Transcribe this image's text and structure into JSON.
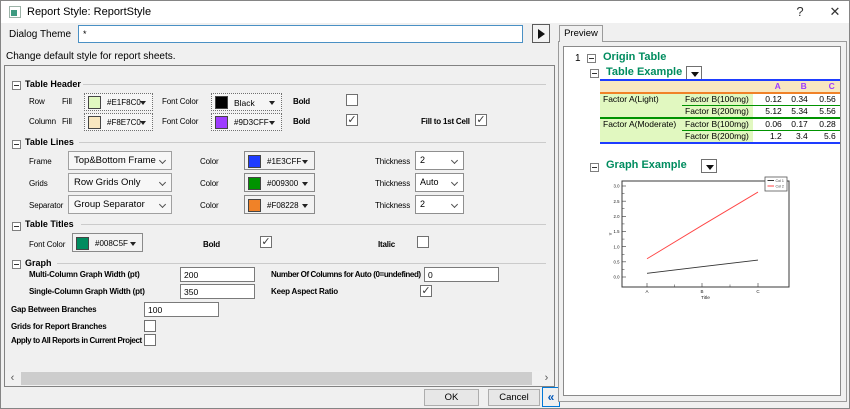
{
  "window": {
    "title": "Report Style: ReportStyle",
    "help": "?",
    "close": "✕"
  },
  "theme_row": {
    "label": "Dialog Theme",
    "value": "*"
  },
  "description": "Change default style for report sheets.",
  "sections": {
    "table_header": {
      "title": "Table Header",
      "row": {
        "label": "Row",
        "fill_label": "Fill",
        "fill_hex": "#E1F8C0",
        "font_color_label": "Font Color",
        "font_color_name": "Black",
        "font_color_hex": "#000000",
        "bold_label": "Bold",
        "bold_checked": false
      },
      "column": {
        "label": "Column",
        "fill_label": "Fill",
        "fill_hex": "#F8E7C0",
        "font_color_label": "Font Color",
        "font_color_hex": "#9D3CFF",
        "bold_label": "Bold",
        "bold_checked": true,
        "fill_first_label": "Fill to 1st Cell",
        "fill_first_checked": true
      }
    },
    "table_lines": {
      "title": "Table Lines",
      "rows": [
        {
          "label": "Frame",
          "value": "Top&Bottom Frame",
          "color_label": "Color",
          "color_hex": "#1E3CFF",
          "thickness_label": "Thickness",
          "thickness": "2"
        },
        {
          "label": "Grids",
          "value": "Row Grids Only",
          "color_label": "Color",
          "color_hex": "#009300",
          "thickness_label": "Thickness",
          "thickness": "Auto"
        },
        {
          "label": "Separator",
          "value": "Group Separator",
          "color_label": "Color",
          "color_hex": "#F08228",
          "thickness_label": "Thickness",
          "thickness": "2"
        }
      ]
    },
    "table_titles": {
      "title": "Table Titles",
      "font_color_label": "Font Color",
      "font_color_hex": "#008C5F",
      "bold_label": "Bold",
      "bold_checked": true,
      "italic_label": "Italic",
      "italic_checked": false
    },
    "graph": {
      "title": "Graph",
      "multi_label": "Multi-Column Graph Width (pt)",
      "multi_value": "200",
      "columns_auto_label": "Number Of Columns for Auto (0=undefined)",
      "columns_auto_value": "0",
      "single_label": "Single-Column Graph Width (pt)",
      "single_value": "350",
      "keep_aspect_label": "Keep Aspect Ratio",
      "keep_aspect_checked": true,
      "gap_label": "Gap Between Branches",
      "gap_value": "100",
      "grids_label": "Grids for Report Branches",
      "grids_checked": false,
      "apply_label": "Apply to All Reports in Current Project",
      "apply_checked": false
    }
  },
  "buttons": {
    "ok": "OK",
    "cancel": "Cancel",
    "collapse": "«"
  },
  "preview": {
    "tab": "Preview",
    "tree_number": "1",
    "origin_table_label": "Origin Table",
    "table_example_label": "Table Example",
    "graph_example_label": "Graph Example",
    "title_color": "#008C5F",
    "table": {
      "columns": [
        "A",
        "B",
        "C"
      ],
      "groups": [
        {
          "factor_a": "Factor A(Light)",
          "rows": [
            {
              "factor_b": "Factor B(100mg)",
              "values": [
                "0.12",
                "0.34",
                "0.56"
              ]
            },
            {
              "factor_b": "Factor B(200mg)",
              "values": [
                "5.12",
                "5.34",
                "5.56"
              ]
            }
          ]
        },
        {
          "factor_a": "Factor A(Moderate)",
          "rows": [
            {
              "factor_b": "Factor B(100mg)",
              "values": [
                "0.06",
                "0.17",
                "0.28"
              ]
            },
            {
              "factor_b": "Factor B(200mg)",
              "values": [
                "1.2",
                "3.4",
                "5.6"
              ]
            }
          ]
        }
      ],
      "header_fill": "#F8E7C0",
      "row_fill": "#E1F8C0",
      "header_font_color": "#9D3CFF",
      "frame_color": "#1E3CFF",
      "grid_color": "#009300",
      "separator_color": "#F08228"
    },
    "chart_data": {
      "type": "line",
      "x": [
        "A",
        "B",
        "C"
      ],
      "series": [
        {
          "name": "Col 1",
          "color": "#333333",
          "values": [
            0.12,
            0.34,
            0.56
          ]
        },
        {
          "name": "Col 2",
          "color": "#FF4444",
          "values": [
            0.6,
            1.7,
            2.8
          ]
        }
      ],
      "xlabel": "Title",
      "ylabel": "Y",
      "ylim": [
        0,
        3
      ],
      "yticks": [
        0,
        0.5,
        1,
        1.5,
        2,
        2.5,
        3
      ],
      "legend_position": "top-right",
      "grid": false
    }
  }
}
